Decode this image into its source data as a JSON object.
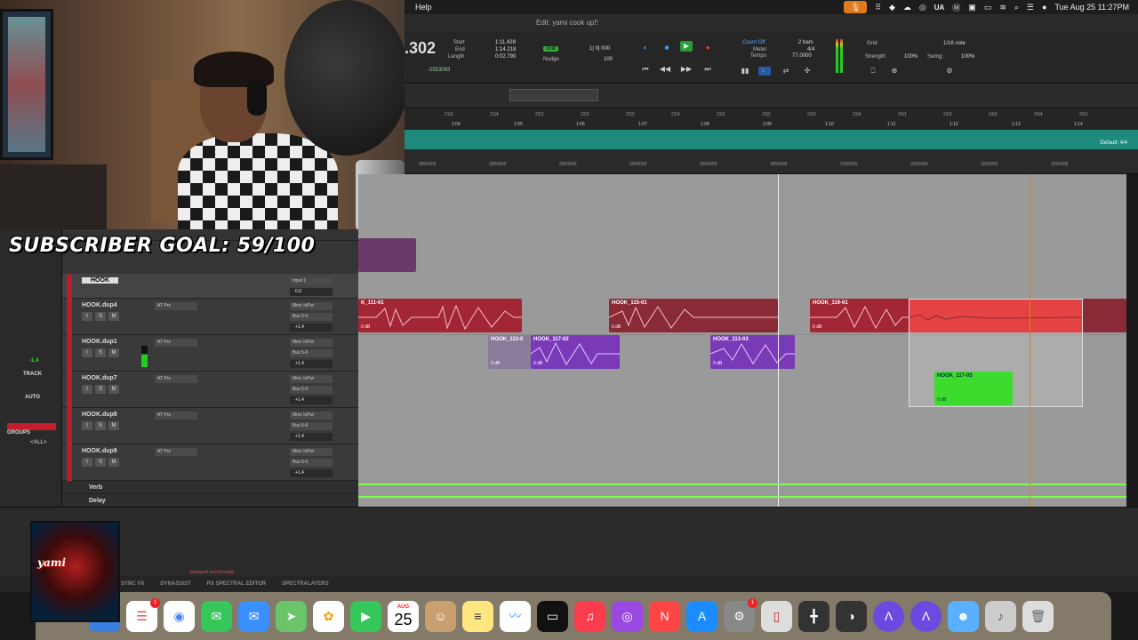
{
  "overlay": {
    "subscriber_goal": "SUBSCRIBER GOAL: 59/100",
    "logo_text": "yami"
  },
  "menubar": {
    "help": "Help",
    "ua": "UA",
    "datetime": "Tue Aug 25  11:27PM"
  },
  "window": {
    "title": "Edit: yami cook up!!"
  },
  "transport": {
    "counter": ".302",
    "start_label": "Start",
    "end_label": "End",
    "length_label": "Length",
    "start_value": "1:11.428",
    "end_value": "1:14.218",
    "length_value": "0:02.790",
    "cursor_value": "-2553093",
    "grid_label": "Grid",
    "grid_value": "1| 0| 000",
    "nudge_label": "Nudge",
    "nudge_value": "100",
    "count_off": "Count Off",
    "meter_label": "Meter",
    "tempo_label": "Tempo",
    "count_bars": "2 bars",
    "meter_value": "4/4",
    "tempo_value": "77.0000",
    "grid_right_label": "Grid:",
    "grid_right_value": "1/16 note",
    "strength_label": "Strength:",
    "strength_value": "100%",
    "swing_label": "Swing:",
    "swing_value": "100%"
  },
  "ruler": {
    "bars": [
      "21|3",
      "21|4",
      "22|1",
      "22|2",
      "22|3",
      "22|4",
      "23|1",
      "23|2",
      "23|3",
      "23|4",
      "24|1",
      "24|2",
      "24|3",
      "24|4",
      "25|1"
    ],
    "mins": [
      "1:04",
      "1:05",
      "1:06",
      "1:07",
      "1:08",
      "1:09",
      "1:10",
      "1:11",
      "1:12",
      "1:13",
      "1:14"
    ],
    "samples": [
      "2800000",
      "2850000",
      "2900000",
      "2950000",
      "3000000",
      "3050000",
      "3100000",
      "3150000",
      "3200000",
      "3250000"
    ],
    "default_meter": "Default: 4/4"
  },
  "tracks": [
    {
      "name": "HOOK",
      "input": "Input 1",
      "bus": "Bs 5-6",
      "vol": "0.0"
    },
    {
      "name": "HOOK.dup4",
      "plugin": "AT Pro",
      "input": "Mmc InPut",
      "bus": "Bus 5-6",
      "vol": "+1.4"
    },
    {
      "name": "HOOK.dup1",
      "plugin": "AT Pro",
      "input": "Mmc InPut",
      "bus": "Bus 5-6",
      "vol": "+1.4"
    },
    {
      "name": "HOOK.dup7",
      "plugin": "AT Pro",
      "input": "Mmc InPut",
      "bus": "Bus 5-6",
      "vol": "+1.4"
    },
    {
      "name": "HOOK.dup8",
      "plugin": "AT Pro",
      "input": "Mmc InPut",
      "bus": "Bus 5-6",
      "vol": "+1.4"
    },
    {
      "name": "HOOK.dup9",
      "plugin": "AT Pro",
      "input": "Mmc InPut",
      "bus": "Bus 5-6",
      "vol": "+1.4"
    }
  ],
  "aux_tracks": [
    {
      "name": "Verb"
    },
    {
      "name": "Delay"
    }
  ],
  "track_buttons": {
    "input": "I",
    "solo": "S",
    "mute": "M"
  },
  "clips": [
    {
      "name": "K_111-01",
      "gain": "0 dB",
      "color": "red"
    },
    {
      "name": "HOOK_115-01",
      "gain": "0 dB",
      "color": "red"
    },
    {
      "name": "HOOK_119-01",
      "gain": "0 dB",
      "color": "red"
    },
    {
      "name": "HOOK_113-0",
      "gain": "0 dB",
      "color": "purple-dim"
    },
    {
      "name": "HOOK_117-02",
      "gain": "0 dB",
      "color": "purple"
    },
    {
      "name": "HOOK_113-03",
      "gain": "0 dB",
      "color": "purple"
    },
    {
      "name": "HOOK_117-05",
      "gain": "0 dB",
      "color": "green"
    }
  ],
  "left_panel": {
    "track_label": "TRACK",
    "auto_label": "AUTO",
    "groups_label": "GROUPS",
    "all_label": "<ALL>",
    "level_value": "-1.4"
  },
  "status": {
    "message": "transport record ready"
  },
  "plugin_bar": [
    "SYNC VX",
    "DYNASSIST",
    "RX SPECTRAL EDITOR",
    "SPECTRALAYERS"
  ],
  "dock": {
    "calendar_month": "AUG",
    "calendar_day": "25",
    "badges": {
      "reminders": "1",
      "settings": "1"
    },
    "apps": [
      "finder-icon",
      "launchpad-icon",
      "safari-icon",
      "reminders-icon",
      "chrome-icon",
      "messages-icon",
      "mail-icon",
      "maps-icon",
      "photos-icon",
      "facetime-icon",
      "calendar-icon",
      "contacts-icon",
      "notes-icon",
      "freeform-icon",
      "tv-icon",
      "music-icon",
      "podcasts-icon",
      "news-icon",
      "appstore-icon",
      "settings-icon",
      "iphone-mirroring-icon",
      "audio-midi-icon",
      "ua-connect-icon",
      "avid-icon",
      "avid-icon-2",
      "finder-app-icon",
      "music-file-icon",
      "trash-icon"
    ]
  },
  "colors": {
    "tempo_lane": "#1e8a7c",
    "clip_red": "#a22633",
    "clip_selected_red": "#e01a1a",
    "clip_purple": "#7a3ab8",
    "clip_green": "#3ddb2d",
    "playhead_orange": "#d08a1e"
  }
}
